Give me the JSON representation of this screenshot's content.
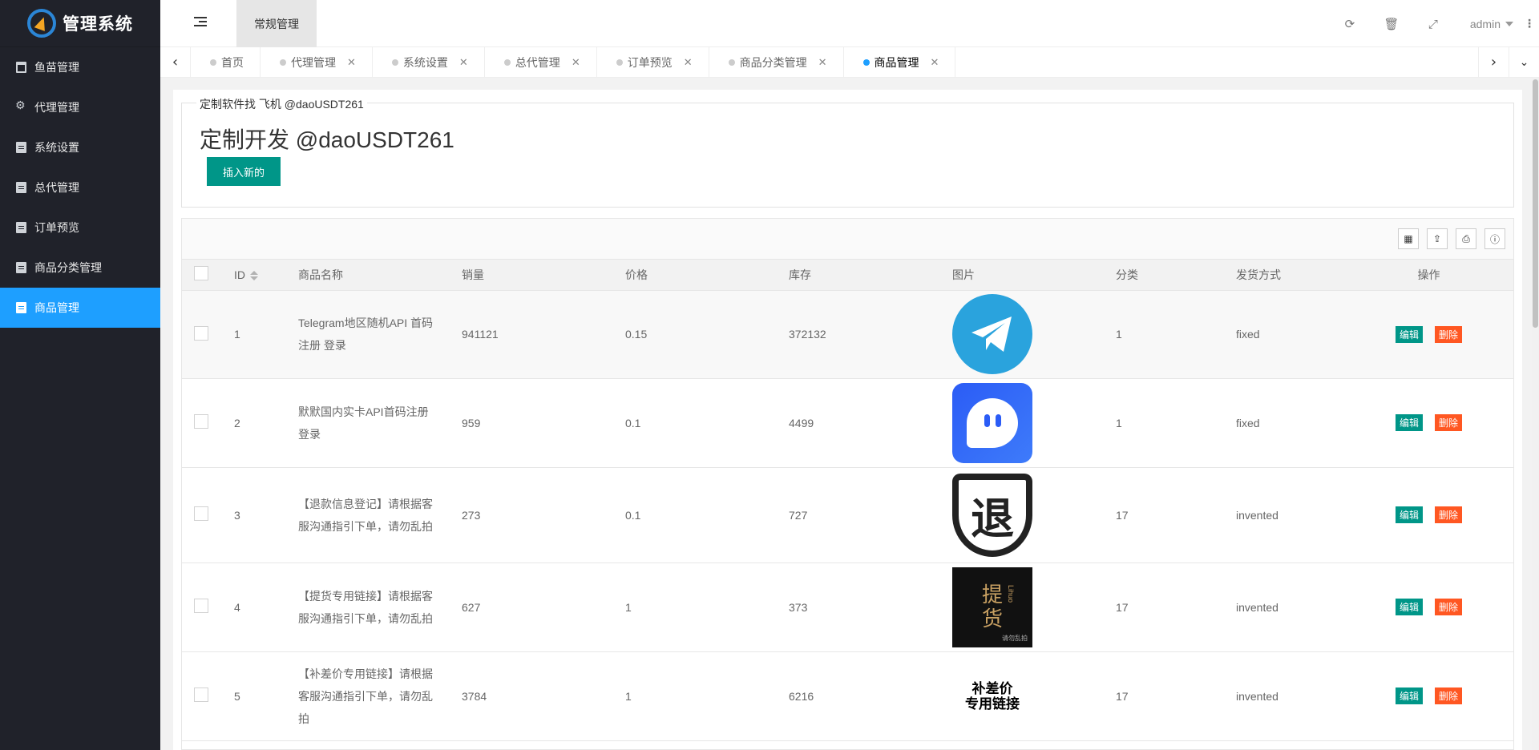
{
  "app": {
    "title": "管理系统"
  },
  "sidebar": {
    "items": [
      {
        "label": "鱼苗管理",
        "icon": "window-icon",
        "active": false
      },
      {
        "label": "代理管理",
        "icon": "gears-icon",
        "active": false
      },
      {
        "label": "系统设置",
        "icon": "document-icon",
        "active": false
      },
      {
        "label": "总代管理",
        "icon": "document-icon",
        "active": false
      },
      {
        "label": "订单预览",
        "icon": "document-icon",
        "active": false
      },
      {
        "label": "商品分类管理",
        "icon": "document-icon",
        "active": false
      },
      {
        "label": "商品管理",
        "icon": "document-icon",
        "active": true
      }
    ]
  },
  "header": {
    "tab_label": "常规管理",
    "user": "admin"
  },
  "tabs": [
    {
      "label": "首页",
      "closable": false,
      "active": false
    },
    {
      "label": "代理管理",
      "closable": true,
      "active": false
    },
    {
      "label": "系统设置",
      "closable": true,
      "active": false
    },
    {
      "label": "总代管理",
      "closable": true,
      "active": false
    },
    {
      "label": "订单预览",
      "closable": true,
      "active": false
    },
    {
      "label": "商品分类管理",
      "closable": true,
      "active": false
    },
    {
      "label": "商品管理",
      "closable": true,
      "active": true
    }
  ],
  "panel": {
    "legend": "定制软件找 飞机 @daoUSDT261",
    "title": "定制开发 @daoUSDT261",
    "insert_button": "插入新的"
  },
  "table": {
    "columns": [
      "ID",
      "商品名称",
      "销量",
      "价格",
      "库存",
      "图片",
      "分类",
      "发货方式",
      "操作"
    ],
    "edit_label": "编辑",
    "delete_label": "删除",
    "rows": [
      {
        "id": "1",
        "name": "Telegram地区随机API 首码注册 登录",
        "sales": "941121",
        "price": "0.15",
        "stock": "372132",
        "image": "telegram-logo",
        "category": "1",
        "delivery": "fixed"
      },
      {
        "id": "2",
        "name": "默默国内实卡API首码注册登录",
        "sales": "959",
        "price": "0.1",
        "stock": "4499",
        "image": "chat-app-logo",
        "category": "1",
        "delivery": "fixed"
      },
      {
        "id": "3",
        "name": "【退款信息登记】请根据客服沟通指引下单，请勿乱拍",
        "sales": "273",
        "price": "0.1",
        "stock": "727",
        "image": "refund-shield",
        "category": "17",
        "delivery": "invented"
      },
      {
        "id": "4",
        "name": "【提货专用链接】请根据客服沟通指引下单，请勿乱拍",
        "sales": "627",
        "price": "1",
        "stock": "373",
        "image": "pickup-card",
        "category": "17",
        "delivery": "invented"
      },
      {
        "id": "5",
        "name": "【补差价专用链接】请根据客服沟通指引下单，请勿乱拍",
        "sales": "3784",
        "price": "1",
        "stock": "6216",
        "image": "price-diff-card",
        "category": "17",
        "delivery": "invented"
      }
    ]
  },
  "images": {
    "refund_char": "退",
    "pickup_chars": [
      "提",
      "货"
    ],
    "pickup_side": "Lihuo",
    "pickup_note": "请勿乱拍",
    "bucha_line1": "补差价",
    "bucha_line2": "专用链接"
  },
  "colors": {
    "sidebar_bg": "#20222a",
    "active_blue": "#1e9fff",
    "edit_green": "#009688",
    "delete_orange": "#ff5722"
  }
}
